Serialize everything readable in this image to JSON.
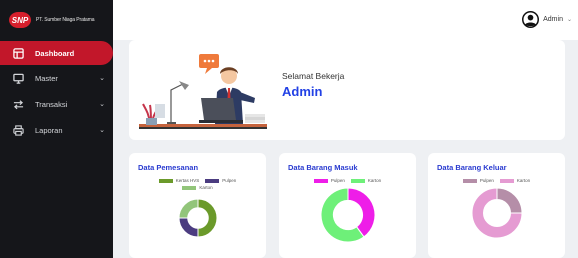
{
  "brand": {
    "logo_text": "SNP",
    "name": "PT. Sumber Niaga Pratama"
  },
  "sidebar": {
    "items": [
      {
        "label": "Dashboard",
        "icon": "dashboard-icon",
        "active": true
      },
      {
        "label": "Master",
        "icon": "monitor-icon",
        "chevron": "⌄"
      },
      {
        "label": "Transaksi",
        "icon": "transfer-icon",
        "chevron": "⌄"
      },
      {
        "label": "Laporan",
        "icon": "printer-icon",
        "chevron": "⌄"
      }
    ]
  },
  "topbar": {
    "user_name": "Admin",
    "user_chevron": "⌄"
  },
  "welcome": {
    "greeting": "Selamat Bekerja",
    "name": "Admin"
  },
  "colors": {
    "accent": "#c2172a",
    "title_blue": "#2a3bd0",
    "name_blue": "#2241e5"
  },
  "chart_data": [
    {
      "type": "pie",
      "title": "Data Pemesanan",
      "categories": [
        "Kertas HVS",
        "Pulpen",
        "Karton"
      ],
      "values": [
        50,
        25,
        25
      ],
      "colors": [
        "#6b9a2a",
        "#4b3c80",
        "#92c57a"
      ],
      "donut": true
    },
    {
      "type": "pie",
      "title": "Data Barang Masuk",
      "categories": [
        "Pulpen",
        "Karton"
      ],
      "values": [
        40,
        60
      ],
      "colors": [
        "#ee1ee8",
        "#6ef079"
      ],
      "donut": true
    },
    {
      "type": "pie",
      "title": "Data Barang Keluar",
      "categories": [
        "Pulpen",
        "Karton"
      ],
      "values": [
        25,
        75
      ],
      "colors": [
        "#b58ea8",
        "#e59bd2"
      ],
      "donut": true
    }
  ]
}
